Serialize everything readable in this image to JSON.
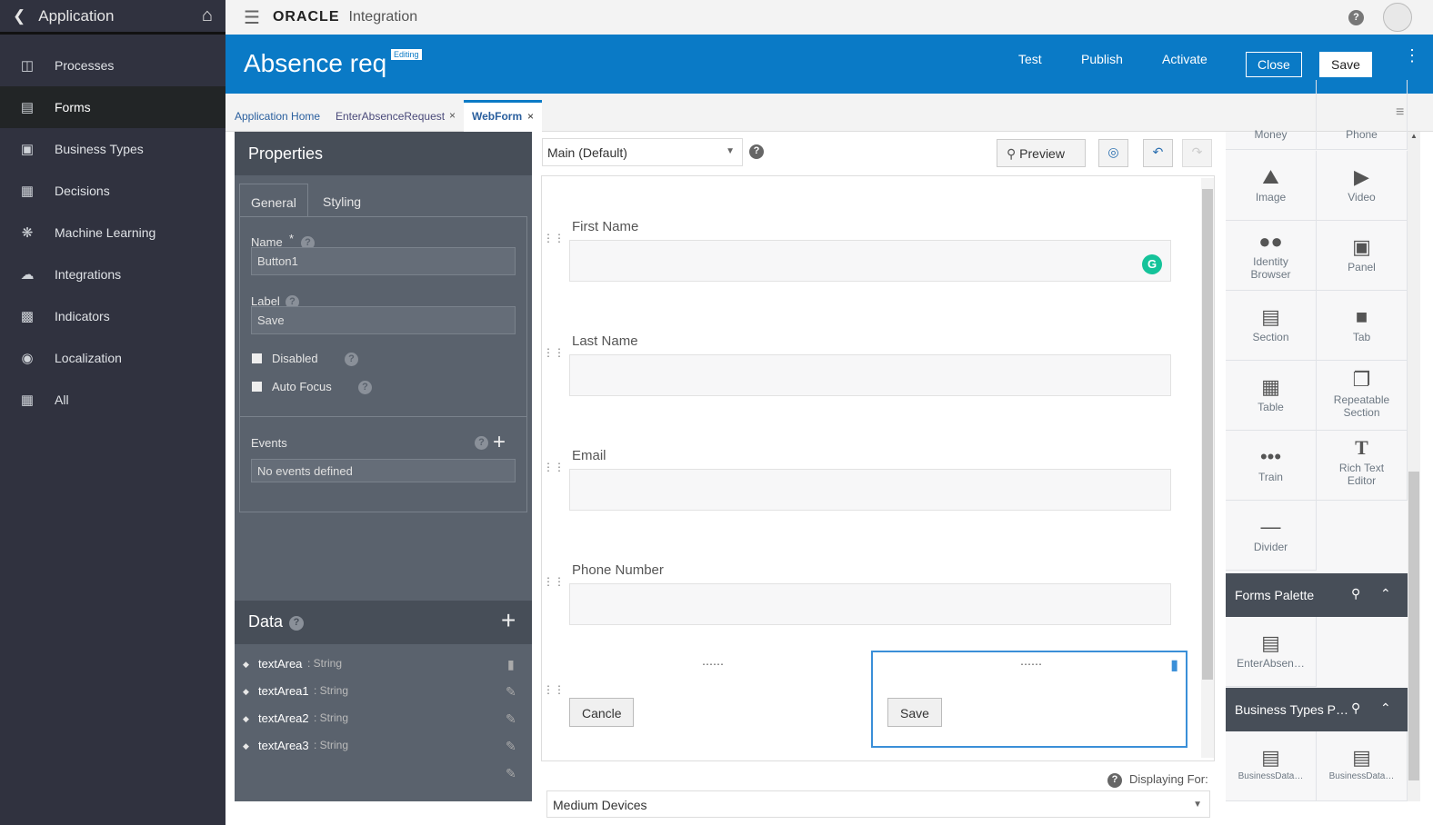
{
  "sidebar": {
    "title": "Application",
    "items": [
      {
        "label": "Processes",
        "icon": "processes-icon"
      },
      {
        "label": "Forms",
        "icon": "forms-icon",
        "active": true
      },
      {
        "label": "Business Types",
        "icon": "business-types-icon"
      },
      {
        "label": "Decisions",
        "icon": "decisions-icon"
      },
      {
        "label": "Machine Learning",
        "icon": "brain-icon"
      },
      {
        "label": "Integrations",
        "icon": "cloud-icon"
      },
      {
        "label": "Indicators",
        "icon": "chart-icon"
      },
      {
        "label": "Localization",
        "icon": "globe-icon"
      },
      {
        "label": "All",
        "icon": "grid-icon"
      }
    ]
  },
  "topbar": {
    "brand": "ORACLE",
    "product": "Integration"
  },
  "header": {
    "title": "Absence req",
    "badge": "Editing",
    "test": "Test",
    "publish": "Publish",
    "activate": "Activate",
    "close": "Close",
    "save": "Save"
  },
  "tabs": [
    {
      "label": "Application Home"
    },
    {
      "label": "EnterAbsenceRequest"
    },
    {
      "label": "WebForm"
    }
  ],
  "properties": {
    "title": "Properties",
    "tab_general": "General",
    "tab_styling": "Styling",
    "name_label": "Name",
    "required_mark": "*",
    "name_value": "Button1",
    "label_label": "Label",
    "label_value": "Save",
    "disabled": "Disabled",
    "autofocus": "Auto Focus",
    "events_label": "Events",
    "events_value": "No events defined"
  },
  "data": {
    "title": "Data",
    "items": [
      {
        "name": "textArea",
        "type": ": String"
      },
      {
        "name": "textArea1",
        "type": ": String"
      },
      {
        "name": "textArea2",
        "type": ": String"
      },
      {
        "name": "textArea3",
        "type": ": String"
      }
    ]
  },
  "canvas": {
    "presentation": "Main (Default)",
    "preview": "Preview",
    "fields": [
      "First Name",
      "Last Name",
      "Email",
      "Phone Number"
    ],
    "cancel": "Cancle",
    "save": "Save",
    "displaying_for": "Displaying For:",
    "device": "Medium Devices"
  },
  "palette": {
    "cut_top": [
      "Money",
      "Phone"
    ],
    "items": [
      "Image",
      "Video",
      "Identity Browser",
      "Panel",
      "Section",
      "Tab",
      "Table",
      "Repeatable Section",
      "Train",
      "Rich Text Editor",
      "Divider"
    ],
    "forms_palette": "Forms Palette",
    "forms_items": [
      "EnterAbsen…"
    ],
    "bt_palette": "Business Types P…",
    "bt_items": [
      "BusinessData…",
      "BusinessData…"
    ]
  }
}
